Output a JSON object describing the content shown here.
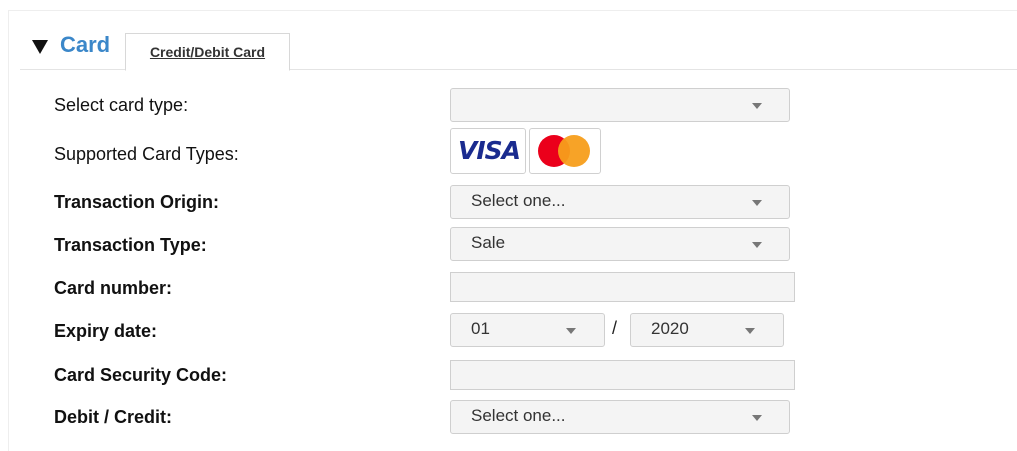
{
  "header": {
    "section_title": "Card",
    "tab_label": "Credit/Debit Card"
  },
  "form": {
    "card_type": {
      "label": "Select card type:",
      "value": ""
    },
    "supported": {
      "label": "Supported Card Types:",
      "visa_text": "VISA",
      "icons": [
        "visa-logo",
        "mastercard-logo"
      ]
    },
    "transaction_origin": {
      "label": "Transaction Origin:",
      "value": "Select one..."
    },
    "transaction_type": {
      "label": "Transaction Type:",
      "value": "Sale"
    },
    "card_number": {
      "label": "Card number:",
      "value": ""
    },
    "expiry": {
      "label": "Expiry date:",
      "month": "01",
      "separator": "/",
      "year": "2020"
    },
    "security_code": {
      "label": "Card Security Code:",
      "value": ""
    },
    "debit_credit": {
      "label": "Debit / Credit:",
      "value": "Select one..."
    }
  },
  "colors": {
    "title": "#3b87c9",
    "visa": "#1a2b8f",
    "mastercard_red": "#eb001b",
    "mastercard_yellow": "#f79e1b"
  }
}
